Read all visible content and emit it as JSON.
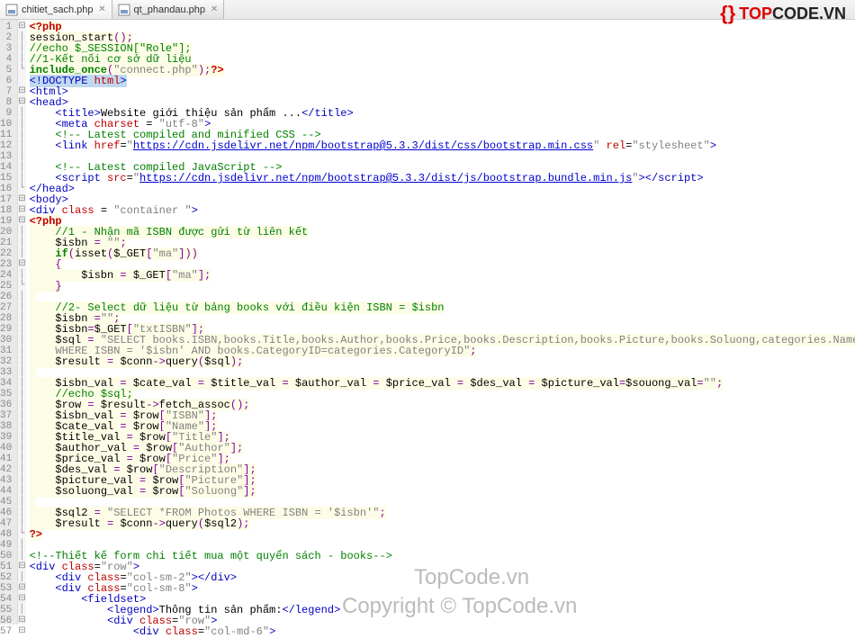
{
  "tabs": [
    {
      "label": "chitiet_sach.php",
      "active": true
    },
    {
      "label": "qt_phandau.php",
      "active": false
    }
  ],
  "logo": {
    "top": "TOP",
    "code": "CODE",
    "tld": ".VN"
  },
  "watermarks": {
    "w1": "TopCode.vn",
    "w2": "Copyright © TopCode.vn"
  },
  "lines": [
    {
      "n": 1,
      "fold": "⊟",
      "cls": "hl-php",
      "html": "<span class='c-phpdelim'>&lt;?php</span>"
    },
    {
      "n": 2,
      "fold": "│",
      "cls": "hl-php",
      "html": "<span class='c-var'>session_start</span><span class='c-op'>();</span>"
    },
    {
      "n": 3,
      "fold": "│",
      "cls": "hl-php",
      "html": "<span class='c-cmt'>//echo $_SESSION[\"Role\"];</span>"
    },
    {
      "n": 4,
      "fold": "│",
      "cls": "hl-php",
      "html": "<span class='c-cmt'>//1-Kết nối cơ sở dữ liệu</span>"
    },
    {
      "n": 5,
      "fold": "└",
      "cls": "hl-php",
      "html": "<span class='c-phpkw'>include_once</span><span class='c-op'>(</span><span class='c-str'>\"connect.php\"</span><span class='c-op'>);</span><span class='c-phpdelim'>?&gt;</span>"
    },
    {
      "n": 6,
      "fold": "",
      "cls": "",
      "html": "<span class='hl-sel'><span class='c-tag'>&lt;!DOCTYPE</span> <span class='c-attr'>html</span><span class='c-tag'>&gt;</span></span>"
    },
    {
      "n": 7,
      "fold": "⊟",
      "cls": "",
      "html": "<span class='c-tag'>&lt;html&gt;</span>"
    },
    {
      "n": 8,
      "fold": "⊟",
      "cls": "",
      "html": "<span class='c-tag'>&lt;head&gt;</span>"
    },
    {
      "n": 9,
      "fold": "│",
      "cls": "",
      "html": "    <span class='c-tag'>&lt;title&gt;</span>Website giới thiệu sản phẩm ...<span class='c-tag'>&lt;/title&gt;</span>"
    },
    {
      "n": 10,
      "fold": "│",
      "cls": "",
      "html": "    <span class='c-tag'>&lt;meta</span> <span class='c-attr'>charset</span> = <span class='c-str'>\"utf-8\"</span><span class='c-tag'>&gt;</span>"
    },
    {
      "n": 11,
      "fold": "│",
      "cls": "",
      "html": "    <span class='c-cmt'>&lt;!-- Latest compiled and minified CSS --&gt;</span>"
    },
    {
      "n": 12,
      "fold": "│",
      "cls": "",
      "html": "    <span class='c-tag'>&lt;link</span> <span class='c-attr'>href</span>=<span class='c-str'>\"</span><span class='c-url'>https://cdn.jsdelivr.net/npm/bootstrap@5.3.3/dist/css/bootstrap.min.css</span><span class='c-str'>\"</span> <span class='c-attr'>rel</span>=<span class='c-str'>\"stylesheet\"</span><span class='c-tag'>&gt;</span>"
    },
    {
      "n": 13,
      "fold": "│",
      "cls": "",
      "html": ""
    },
    {
      "n": 14,
      "fold": "│",
      "cls": "",
      "html": "    <span class='c-cmt'>&lt;!-- Latest compiled JavaScript --&gt;</span>"
    },
    {
      "n": 15,
      "fold": "│",
      "cls": "",
      "html": "    <span class='c-tag'>&lt;script</span> <span class='c-attr'>src</span>=<span class='c-str'>\"</span><span class='c-url'>https://cdn.jsdelivr.net/npm/bootstrap@5.3.3/dist/js/bootstrap.bundle.min.js</span><span class='c-str'>\"</span><span class='c-tag'>&gt;&lt;/script&gt;</span>"
    },
    {
      "n": 16,
      "fold": "└",
      "cls": "",
      "html": "<span class='c-tag'>&lt;/head&gt;</span>"
    },
    {
      "n": 17,
      "fold": "⊟",
      "cls": "",
      "html": "<span class='c-tag'>&lt;body&gt;</span>"
    },
    {
      "n": 18,
      "fold": "⊟",
      "cls": "",
      "html": "<span class='c-tag'>&lt;div</span> <span class='c-attr'>class</span> = <span class='c-str'>\"container \"</span><span class='c-tag'>&gt;</span>"
    },
    {
      "n": 19,
      "fold": "⊟",
      "cls": "hl-php",
      "html": "<span class='c-phpdelim'>&lt;?php</span>"
    },
    {
      "n": 20,
      "fold": "│",
      "cls": "hl-php",
      "html": "    <span class='c-cmt'>//1 - Nhận mã ISBN được gửi từ liên kết</span>"
    },
    {
      "n": 21,
      "fold": "│",
      "cls": "hl-php",
      "html": "    <span class='c-var'>$isbn</span> <span class='c-op'>=</span> <span class='c-str'>\"\"</span><span class='c-op'>;</span>"
    },
    {
      "n": 22,
      "fold": "│",
      "cls": "hl-php",
      "html": "    <span class='c-phpkw'>if</span><span class='c-op'>(</span><span class='c-var'>isset</span><span class='c-op'>(</span><span class='c-var'>$_GET</span><span class='c-op'>[</span><span class='c-str'>\"ma\"</span><span class='c-op'>]))</span>"
    },
    {
      "n": 23,
      "fold": "⊟",
      "cls": "hl-php",
      "html": "    <span class='c-op'>{</span>"
    },
    {
      "n": 24,
      "fold": "│",
      "cls": "hl-php",
      "html": "        <span class='c-var'>$isbn</span> <span class='c-op'>=</span> <span class='c-var'>$_GET</span><span class='c-op'>[</span><span class='c-str'>\"ma\"</span><span class='c-op'>];</span>"
    },
    {
      "n": 25,
      "fold": "└",
      "cls": "hl-php",
      "html": "    <span class='c-op'>}</span>"
    },
    {
      "n": 26,
      "fold": "│",
      "cls": "hl-php",
      "html": ""
    },
    {
      "n": 27,
      "fold": "│",
      "cls": "hl-php",
      "html": "    <span class='c-cmt'>//2- Select dữ liệu từ bảng books với điều kiện ISBN = $isbn</span>"
    },
    {
      "n": 28,
      "fold": "│",
      "cls": "hl-php",
      "html": "    <span class='c-var'>$isbn</span> <span class='c-op'>=</span><span class='c-str'>\"\"</span><span class='c-op'>;</span>"
    },
    {
      "n": 29,
      "fold": "│",
      "cls": "hl-php",
      "html": "    <span class='c-var'>$isbn</span><span class='c-op'>=</span><span class='c-var'>$_GET</span><span class='c-op'>[</span><span class='c-str'>\"txtISBN\"</span><span class='c-op'>];</span>"
    },
    {
      "n": 30,
      "fold": "│",
      "cls": "hl-php",
      "html": "    <span class='c-var'>$sql</span> <span class='c-op'>=</span> <span class='c-str'>\"SELECT books.ISBN,books.Title,books.Author,books.Price,books.Description,books.Picture,books.Soluong,categories.Name FROM books,categories</span>"
    },
    {
      "n": 31,
      "fold": "│",
      "cls": "hl-php",
      "html": "    <span class='c-str'>WHERE ISBN = '$isbn' AND books.CategoryID=categories.CategoryID\"</span><span class='c-op'>;</span>"
    },
    {
      "n": 32,
      "fold": "│",
      "cls": "hl-php",
      "html": "    <span class='c-var'>$result</span> <span class='c-op'>=</span> <span class='c-var'>$conn</span><span class='c-op'>-&gt;</span><span class='c-var'>query</span><span class='c-op'>(</span><span class='c-var'>$sql</span><span class='c-op'>);</span>"
    },
    {
      "n": 33,
      "fold": "│",
      "cls": "hl-php",
      "html": ""
    },
    {
      "n": 34,
      "fold": "│",
      "cls": "hl-php",
      "html": "    <span class='c-var'>$isbn_val</span> <span class='c-op'>=</span> <span class='c-var'>$cate_val</span> <span class='c-op'>=</span> <span class='c-var'>$title_val</span> <span class='c-op'>=</span> <span class='c-var'>$author_val</span> <span class='c-op'>=</span> <span class='c-var'>$price_val</span> <span class='c-op'>=</span> <span class='c-var'>$des_val</span> <span class='c-op'>=</span> <span class='c-var'>$picture_val</span><span class='c-op'>=</span><span class='c-var'>$souong_val</span><span class='c-op'>=</span><span class='c-str'>\"\"</span><span class='c-op'>;</span>"
    },
    {
      "n": 35,
      "fold": "│",
      "cls": "hl-php",
      "html": "    <span class='c-cmt'>//echo $sql;</span>"
    },
    {
      "n": 36,
      "fold": "│",
      "cls": "hl-php",
      "html": "    <span class='c-var'>$row</span> <span class='c-op'>=</span> <span class='c-var'>$result</span><span class='c-op'>-&gt;</span><span class='c-var'>fetch_assoc</span><span class='c-op'>();</span>"
    },
    {
      "n": 37,
      "fold": "│",
      "cls": "hl-php",
      "html": "    <span class='c-var'>$isbn_val</span> <span class='c-op'>=</span> <span class='c-var'>$row</span><span class='c-op'>[</span><span class='c-str'>\"ISBN\"</span><span class='c-op'>];</span>"
    },
    {
      "n": 38,
      "fold": "│",
      "cls": "hl-php",
      "html": "    <span class='c-var'>$cate_val</span> <span class='c-op'>=</span> <span class='c-var'>$row</span><span class='c-op'>[</span><span class='c-str'>\"Name\"</span><span class='c-op'>];</span>"
    },
    {
      "n": 39,
      "fold": "│",
      "cls": "hl-php",
      "html": "    <span class='c-var'>$title_val</span> <span class='c-op'>=</span> <span class='c-var'>$row</span><span class='c-op'>[</span><span class='c-str'>\"Title\"</span><span class='c-op'>];</span>"
    },
    {
      "n": 40,
      "fold": "│",
      "cls": "hl-php",
      "html": "    <span class='c-var'>$author_val</span> <span class='c-op'>=</span> <span class='c-var'>$row</span><span class='c-op'>[</span><span class='c-str'>\"Author\"</span><span class='c-op'>];</span>"
    },
    {
      "n": 41,
      "fold": "│",
      "cls": "hl-php",
      "html": "    <span class='c-var'>$price_val</span> <span class='c-op'>=</span> <span class='c-var'>$row</span><span class='c-op'>[</span><span class='c-str'>\"Price\"</span><span class='c-op'>];</span>"
    },
    {
      "n": 42,
      "fold": "│",
      "cls": "hl-php",
      "html": "    <span class='c-var'>$des_val</span> <span class='c-op'>=</span> <span class='c-var'>$row</span><span class='c-op'>[</span><span class='c-str'>\"Description\"</span><span class='c-op'>];</span>"
    },
    {
      "n": 43,
      "fold": "│",
      "cls": "hl-php",
      "html": "    <span class='c-var'>$picture_val</span> <span class='c-op'>=</span> <span class='c-var'>$row</span><span class='c-op'>[</span><span class='c-str'>\"Picture\"</span><span class='c-op'>];</span>"
    },
    {
      "n": 44,
      "fold": "│",
      "cls": "hl-php",
      "html": "    <span class='c-var'>$soluong_val</span> <span class='c-op'>=</span> <span class='c-var'>$row</span><span class='c-op'>[</span><span class='c-str'>\"Soluong\"</span><span class='c-op'>];</span>"
    },
    {
      "n": 45,
      "fold": "│",
      "cls": "hl-php",
      "html": ""
    },
    {
      "n": 46,
      "fold": "│",
      "cls": "hl-php",
      "html": "    <span class='c-var'>$sql2</span> <span class='c-op'>=</span> <span class='c-str'>\"SELECT *FROM Photos WHERE ISBN = '$isbn'\"</span><span class='c-op'>;</span>"
    },
    {
      "n": 47,
      "fold": "│",
      "cls": "hl-php",
      "html": "    <span class='c-var'>$result</span> <span class='c-op'>=</span> <span class='c-var'>$conn</span><span class='c-op'>-&gt;</span><span class='c-var'>query</span><span class='c-op'>(</span><span class='c-var'>$sql2</span><span class='c-op'>);</span>"
    },
    {
      "n": 48,
      "fold": "└",
      "cls": "hl-php",
      "html": "<span class='c-phpdelim'>?&gt;</span>"
    },
    {
      "n": 49,
      "fold": "│",
      "cls": "",
      "html": ""
    },
    {
      "n": 50,
      "fold": "│",
      "cls": "",
      "html": "<span class='c-cmt'>&lt;!--Thiết kế form chi tiết mua một quyển sách - books--&gt;</span>"
    },
    {
      "n": 51,
      "fold": "⊟",
      "cls": "",
      "html": "<span class='c-tag'>&lt;div</span> <span class='c-attr'>class</span>=<span class='c-str'>\"row\"</span><span class='c-tag'>&gt;</span>"
    },
    {
      "n": 52,
      "fold": "│",
      "cls": "",
      "html": "    <span class='c-tag'>&lt;div</span> <span class='c-attr'>class</span>=<span class='c-str'>\"col-sm-2\"</span><span class='c-tag'>&gt;&lt;/div&gt;</span>"
    },
    {
      "n": 53,
      "fold": "⊟",
      "cls": "",
      "html": "    <span class='c-tag'>&lt;div</span> <span class='c-attr'>class</span>=<span class='c-str'>\"col-sm-8\"</span><span class='c-tag'>&gt;</span>"
    },
    {
      "n": 54,
      "fold": "⊟",
      "cls": "",
      "html": "        <span class='c-tag'>&lt;fieldset&gt;</span>"
    },
    {
      "n": 55,
      "fold": "│",
      "cls": "",
      "html": "            <span class='c-tag'>&lt;legend&gt;</span>Thông tin sản phẩm:<span class='c-tag'>&lt;/legend&gt;</span>"
    },
    {
      "n": 56,
      "fold": "⊟",
      "cls": "",
      "html": "            <span class='c-tag'>&lt;div</span> <span class='c-attr'>class</span>=<span class='c-str'>\"row\"</span><span class='c-tag'>&gt;</span>"
    },
    {
      "n": 57,
      "fold": "⊟",
      "cls": "",
      "html": "                <span class='c-tag'>&lt;div</span> <span class='c-attr'>class</span>=<span class='c-str'>\"col-md-6\"</span><span class='c-tag'>&gt;</span>"
    }
  ]
}
